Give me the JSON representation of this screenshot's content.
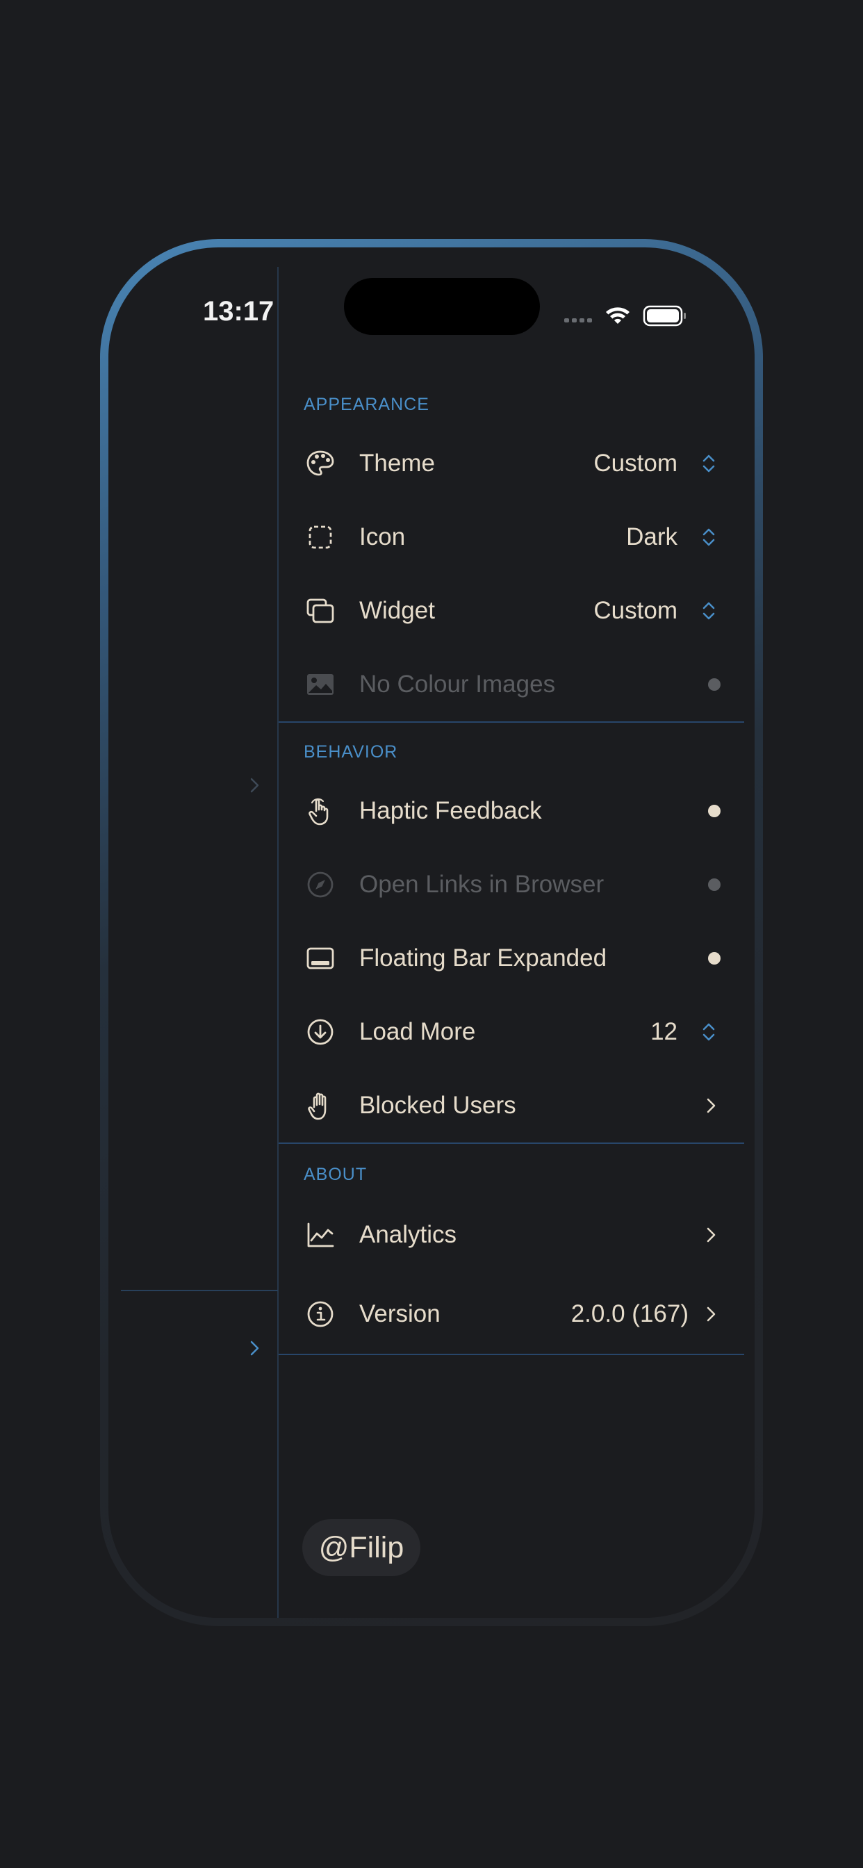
{
  "status_bar": {
    "time": "13:17"
  },
  "sections": {
    "appearance": {
      "label": "APPEARANCE",
      "theme": {
        "label": "Theme",
        "value": "Custom"
      },
      "icon": {
        "label": "Icon",
        "value": "Dark"
      },
      "widget": {
        "label": "Widget",
        "value": "Custom"
      },
      "no_colour_images": {
        "label": "No Colour Images",
        "enabled": false
      }
    },
    "behavior": {
      "label": "BEHAVIOR",
      "haptic_feedback": {
        "label": "Haptic Feedback",
        "enabled": true
      },
      "open_links_in_browser": {
        "label": "Open Links in Browser",
        "enabled": false
      },
      "floating_bar_expanded": {
        "label": "Floating Bar Expanded",
        "enabled": true
      },
      "load_more": {
        "label": "Load More",
        "value": "12"
      },
      "blocked_users": {
        "label": "Blocked Users"
      }
    },
    "about": {
      "label": "ABOUT",
      "analytics": {
        "label": "Analytics"
      },
      "version": {
        "label": "Version",
        "value": "2.0.0 (167)"
      }
    }
  },
  "user_handle": "@Filip",
  "colors": {
    "background": "#1b1c1f",
    "accent": "#4a8fc9",
    "text": "#e6dccb",
    "disabled_text": "#5b5d61",
    "separator": "#28466a"
  }
}
